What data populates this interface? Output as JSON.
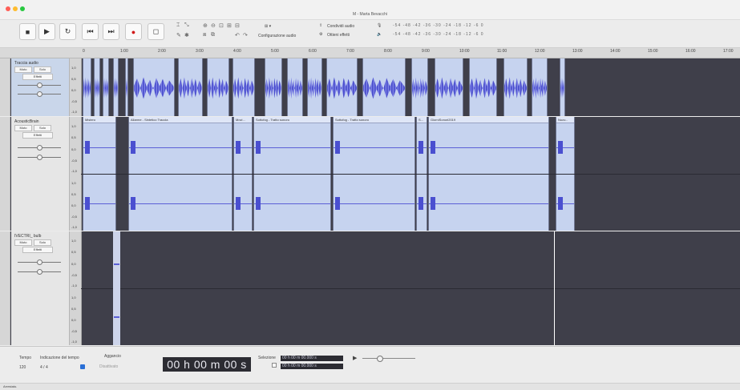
{
  "window": {
    "title": "M - Marta Bevacchi",
    "traffic_lights": [
      "#ff5f57",
      "#febc2e",
      "#28c840"
    ]
  },
  "toolbar": {
    "transport": [
      {
        "name": "stop-button",
        "glyph": "■"
      },
      {
        "name": "play-button",
        "glyph": "▶"
      },
      {
        "name": "loop-button",
        "glyph": "↻"
      },
      {
        "name": "skip-start-button",
        "glyph": "⏮"
      },
      {
        "name": "skip-end-button",
        "glyph": "⏭"
      },
      {
        "name": "record-button",
        "glyph": "●"
      },
      {
        "name": "extra-button",
        "glyph": "◻"
      }
    ],
    "audio_setup_label": "Configurazione audio",
    "share_audio_label": "Condividi audio",
    "effects_label": "Ottieni effetti"
  },
  "ruler": {
    "ticks": [
      "0",
      "1:00",
      "2:00",
      "3:00",
      "4:00",
      "5:00",
      "6:00",
      "7:00",
      "8:00",
      "9:00",
      "10:00",
      "11:00",
      "12:00",
      "13:00",
      "14:00",
      "15:00",
      "16:00",
      "17:00"
    ]
  },
  "tracks": [
    {
      "name": "Traccia audio",
      "mute": "Muto",
      "solo": "Solo",
      "effects": "Effetti",
      "scale": [
        "1,0",
        "0,5",
        "0,0",
        "-0,5",
        "-1,0"
      ],
      "selected": true
    },
    {
      "name": "AcousticBrain",
      "mute": "Muto",
      "solo": "Solo",
      "effects": "Effetti",
      "scale": [
        "1,0",
        "0,5",
        "0,0",
        "-0,5",
        "-1,0"
      ],
      "selected": false,
      "clips": [
        "Mistero",
        "Allarme - Sintetico Traccia",
        "Movi...",
        "Sottofog - Tratto sonoro",
        "Sottofog - Tratto sonoro",
        "S...",
        "GiorniSonori2019",
        "Nuov..."
      ]
    },
    {
      "name": "IVECTRI_ bulb",
      "mute": "Muto",
      "solo": "Solo",
      "effects": "Effetti",
      "scale": [
        "1,0",
        "0,5",
        "0,0",
        "-0,5",
        "-1,0"
      ],
      "selected": false
    }
  ],
  "bottom": {
    "tempo_label": "Tempo",
    "tempo_value": "120",
    "time_signature_label": "Indicazione del tempo",
    "time_signature_value": "4 / 4",
    "snap_label": "Aggancio",
    "snap_value": "Disattivato",
    "timecode": "00 h 00 m 00 s",
    "selection_label": "Selezione",
    "selection_start": "00 h 00 m 00.000 s",
    "selection_end": "00 h 00 m 00.000 s"
  },
  "status": {
    "text": "Arrestato."
  },
  "colors": {
    "wave": "#5b5fd6",
    "clip": "#c6d3ef",
    "track_bg": "#3f3f4a"
  }
}
